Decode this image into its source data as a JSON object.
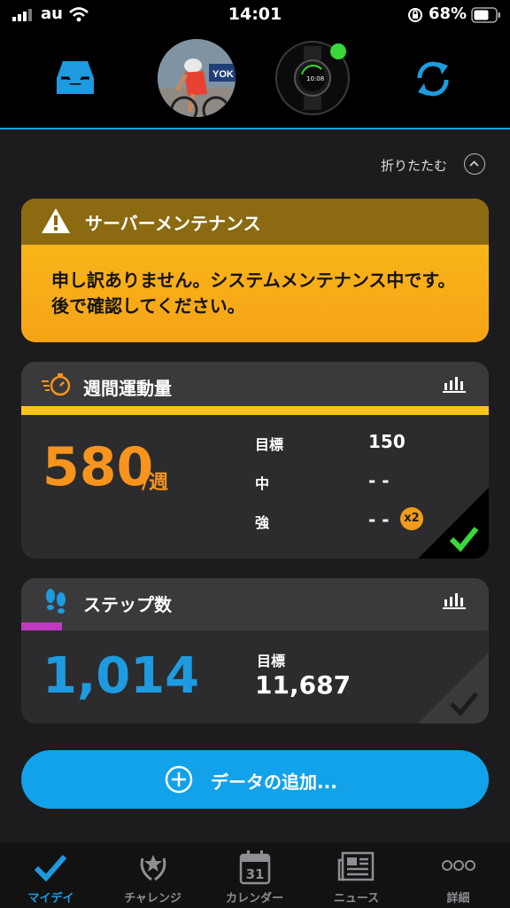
{
  "status_bar": {
    "carrier": "au",
    "time": "14:01",
    "battery_pct": "68%"
  },
  "header": {
    "collapse_label": "折りたたむ"
  },
  "alert": {
    "title": "サーバーメンテナンス",
    "message": "申し訳ありません。システムメンテナンス中です。後で確認してください。"
  },
  "weekly_activity": {
    "title": "週間運動量",
    "value": "580",
    "unit": "/週",
    "progress": 1.0,
    "goal_label": "目標",
    "goal_value": "150",
    "moderate_label": "中",
    "moderate_value": "- -",
    "vigorous_label": "強",
    "vigorous_value": "- -",
    "multiplier_badge": "x2",
    "accent_color": "#f7941d"
  },
  "steps": {
    "title": "ステップ数",
    "value": "1,014",
    "progress": 0.087,
    "goal_label": "目標",
    "goal_value": "11,687",
    "accent_color": "#1e9be0",
    "progress_color": "#c03ac0"
  },
  "add_data": {
    "label": "データの追加..."
  },
  "tabs": [
    {
      "label": "マイデイ",
      "icon": "check-icon",
      "active": true
    },
    {
      "label": "チャレンジ",
      "icon": "laurel-icon",
      "active": false
    },
    {
      "label": "カレンダー",
      "icon": "calendar-icon",
      "active": false,
      "icon_text": "31"
    },
    {
      "label": "ニュース",
      "icon": "newspaper-icon",
      "active": false
    },
    {
      "label": "詳細",
      "icon": "more-icon",
      "active": false
    }
  ],
  "colors": {
    "brand_blue": "#1e9be0",
    "alert_yellow": "#f9b31a",
    "success_green": "#3ad83a"
  }
}
